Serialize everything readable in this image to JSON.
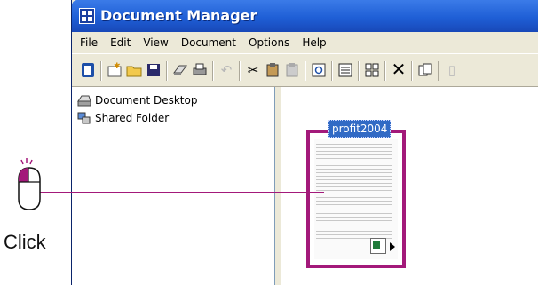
{
  "window": {
    "title": "Document Manager",
    "app_icon": "grid-icon"
  },
  "menu": [
    "File",
    "Edit",
    "View",
    "Document",
    "Options",
    "Help"
  ],
  "toolbar": [
    "new-document-icon",
    "new-folder-icon",
    "open-icon",
    "save-icon",
    "scan-icon",
    "print-icon",
    "undo-icon",
    "cut-icon",
    "copy-icon",
    "paste-icon",
    "preview-icon",
    "list-view-icon",
    "thumbnail-view-icon",
    "delete-icon",
    "duplicate-icon",
    "more-icon"
  ],
  "tree": [
    {
      "label": "Document Desktop",
      "icon": "desktop-tray-icon"
    },
    {
      "label": "Shared Folder",
      "icon": "shared-folder-icon"
    }
  ],
  "document": {
    "label": "profit2004",
    "app_icon": "excel-icon"
  },
  "callout": {
    "label": "Click",
    "icon": "mouse-icon",
    "color": "#a3197a"
  }
}
